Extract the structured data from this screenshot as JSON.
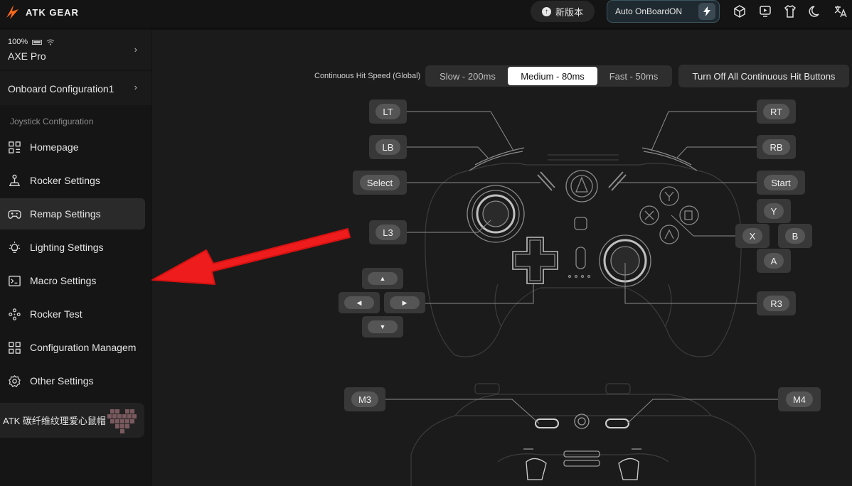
{
  "brand": {
    "name": "ATK GEAR"
  },
  "topbar": {
    "new_version_label": "新版本",
    "auto_onboard_label": "Auto OnBoardON"
  },
  "device": {
    "battery": "100%",
    "name": "AXE Pro"
  },
  "config": {
    "name": "Onboard Configuration1"
  },
  "sidebar": {
    "section_title": "Joystick Configuration",
    "items": [
      {
        "label": "Homepage"
      },
      {
        "label": "Rocker Settings"
      },
      {
        "label": "Remap Settings"
      },
      {
        "label": "Lighting Settings"
      },
      {
        "label": "Macro Settings"
      },
      {
        "label": "Rocker Test"
      },
      {
        "label": "Configuration Managem"
      },
      {
        "label": "Other Settings"
      }
    ],
    "active_item": "Remap Settings",
    "profile": {
      "label": "ATK 碳纤维纹理爱心鼠帽"
    }
  },
  "speed": {
    "label": "Continuous Hit Speed (Global)",
    "options": [
      "Slow - 200ms",
      "Medium - 80ms",
      "Fast - 50ms"
    ],
    "selected": "Medium - 80ms",
    "turn_off_label": "Turn Off All Continuous Hit Buttons"
  },
  "buttons": {
    "lt": "LT",
    "lb": "LB",
    "select": "Select",
    "l3": "L3",
    "rt": "RT",
    "rb": "RB",
    "start": "Start",
    "y": "Y",
    "x": "X",
    "b": "B",
    "a": "A",
    "r3": "R3",
    "m3": "M3",
    "m4": "M4",
    "dpad_up": "▲",
    "dpad_left": "◀",
    "dpad_right": "▶",
    "dpad_down": "▼"
  },
  "colors": {
    "accent_arrow": "#ee1c1c",
    "active_bg": "#2a2a2a",
    "selected_speed_bg": "#ffffff"
  }
}
